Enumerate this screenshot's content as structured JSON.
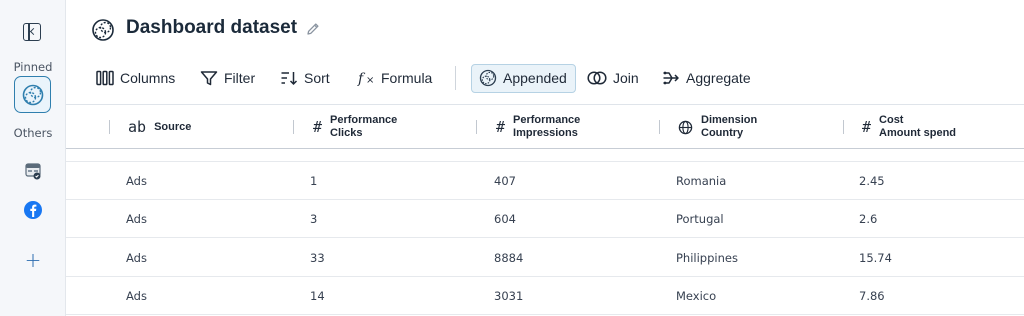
{
  "sidebar": {
    "pinned_label": "Pinned",
    "others_label": "Others",
    "add_label": "+"
  },
  "header": {
    "title": "Dashboard dataset"
  },
  "toolbar": {
    "columns": "Columns",
    "filter": "Filter",
    "sort": "Sort",
    "formula": "Formula",
    "appended": "Appended",
    "join": "Join",
    "aggregate": "Aggregate"
  },
  "table": {
    "columns": [
      {
        "type_icon": "ab",
        "line1": "Source",
        "line2": ""
      },
      {
        "type_icon": "#",
        "line1": "Performance",
        "line2": "Clicks"
      },
      {
        "type_icon": "#",
        "line1": "Performance",
        "line2": "Impressions"
      },
      {
        "type_icon": "globe",
        "line1": "Dimension",
        "line2": "Country"
      },
      {
        "type_icon": "#",
        "line1": "Cost",
        "line2": "Amount spend"
      }
    ],
    "rows": [
      [
        "Ads",
        "1",
        "407",
        "Romania",
        "2.45"
      ],
      [
        "Ads",
        "3",
        "604",
        "Portugal",
        "2.6"
      ],
      [
        "Ads",
        "33",
        "8884",
        "Philippines",
        "15.74"
      ],
      [
        "Ads",
        "14",
        "3031",
        "Mexico",
        "7.86"
      ]
    ]
  },
  "colors": {
    "accent": "#2f7fae",
    "facebook": "#1877f2",
    "appended_bg": "#eaf3f9"
  }
}
